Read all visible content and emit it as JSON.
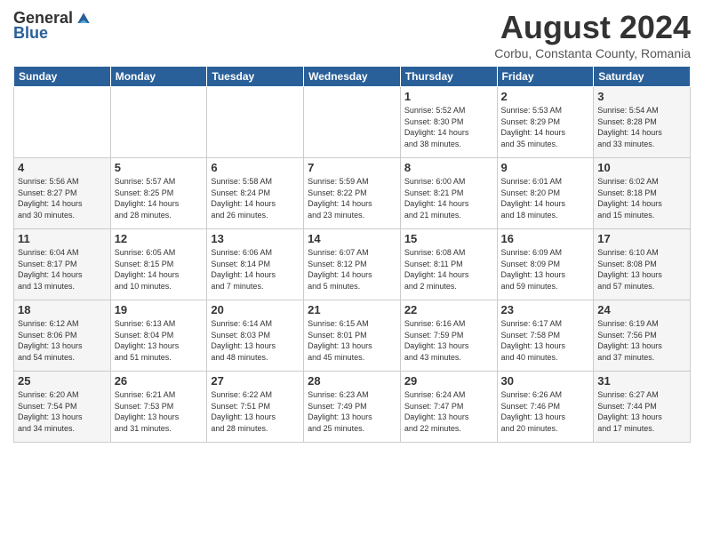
{
  "logo": {
    "general": "General",
    "blue": "Blue"
  },
  "title": "August 2024",
  "subtitle": "Corbu, Constanta County, Romania",
  "weekdays": [
    "Sunday",
    "Monday",
    "Tuesday",
    "Wednesday",
    "Thursday",
    "Friday",
    "Saturday"
  ],
  "weeks": [
    [
      {
        "day": "",
        "info": ""
      },
      {
        "day": "",
        "info": ""
      },
      {
        "day": "",
        "info": ""
      },
      {
        "day": "",
        "info": ""
      },
      {
        "day": "1",
        "info": "Sunrise: 5:52 AM\nSunset: 8:30 PM\nDaylight: 14 hours\nand 38 minutes."
      },
      {
        "day": "2",
        "info": "Sunrise: 5:53 AM\nSunset: 8:29 PM\nDaylight: 14 hours\nand 35 minutes."
      },
      {
        "day": "3",
        "info": "Sunrise: 5:54 AM\nSunset: 8:28 PM\nDaylight: 14 hours\nand 33 minutes."
      }
    ],
    [
      {
        "day": "4",
        "info": "Sunrise: 5:56 AM\nSunset: 8:27 PM\nDaylight: 14 hours\nand 30 minutes."
      },
      {
        "day": "5",
        "info": "Sunrise: 5:57 AM\nSunset: 8:25 PM\nDaylight: 14 hours\nand 28 minutes."
      },
      {
        "day": "6",
        "info": "Sunrise: 5:58 AM\nSunset: 8:24 PM\nDaylight: 14 hours\nand 26 minutes."
      },
      {
        "day": "7",
        "info": "Sunrise: 5:59 AM\nSunset: 8:22 PM\nDaylight: 14 hours\nand 23 minutes."
      },
      {
        "day": "8",
        "info": "Sunrise: 6:00 AM\nSunset: 8:21 PM\nDaylight: 14 hours\nand 21 minutes."
      },
      {
        "day": "9",
        "info": "Sunrise: 6:01 AM\nSunset: 8:20 PM\nDaylight: 14 hours\nand 18 minutes."
      },
      {
        "day": "10",
        "info": "Sunrise: 6:02 AM\nSunset: 8:18 PM\nDaylight: 14 hours\nand 15 minutes."
      }
    ],
    [
      {
        "day": "11",
        "info": "Sunrise: 6:04 AM\nSunset: 8:17 PM\nDaylight: 14 hours\nand 13 minutes."
      },
      {
        "day": "12",
        "info": "Sunrise: 6:05 AM\nSunset: 8:15 PM\nDaylight: 14 hours\nand 10 minutes."
      },
      {
        "day": "13",
        "info": "Sunrise: 6:06 AM\nSunset: 8:14 PM\nDaylight: 14 hours\nand 7 minutes."
      },
      {
        "day": "14",
        "info": "Sunrise: 6:07 AM\nSunset: 8:12 PM\nDaylight: 14 hours\nand 5 minutes."
      },
      {
        "day": "15",
        "info": "Sunrise: 6:08 AM\nSunset: 8:11 PM\nDaylight: 14 hours\nand 2 minutes."
      },
      {
        "day": "16",
        "info": "Sunrise: 6:09 AM\nSunset: 8:09 PM\nDaylight: 13 hours\nand 59 minutes."
      },
      {
        "day": "17",
        "info": "Sunrise: 6:10 AM\nSunset: 8:08 PM\nDaylight: 13 hours\nand 57 minutes."
      }
    ],
    [
      {
        "day": "18",
        "info": "Sunrise: 6:12 AM\nSunset: 8:06 PM\nDaylight: 13 hours\nand 54 minutes."
      },
      {
        "day": "19",
        "info": "Sunrise: 6:13 AM\nSunset: 8:04 PM\nDaylight: 13 hours\nand 51 minutes."
      },
      {
        "day": "20",
        "info": "Sunrise: 6:14 AM\nSunset: 8:03 PM\nDaylight: 13 hours\nand 48 minutes."
      },
      {
        "day": "21",
        "info": "Sunrise: 6:15 AM\nSunset: 8:01 PM\nDaylight: 13 hours\nand 45 minutes."
      },
      {
        "day": "22",
        "info": "Sunrise: 6:16 AM\nSunset: 7:59 PM\nDaylight: 13 hours\nand 43 minutes."
      },
      {
        "day": "23",
        "info": "Sunrise: 6:17 AM\nSunset: 7:58 PM\nDaylight: 13 hours\nand 40 minutes."
      },
      {
        "day": "24",
        "info": "Sunrise: 6:19 AM\nSunset: 7:56 PM\nDaylight: 13 hours\nand 37 minutes."
      }
    ],
    [
      {
        "day": "25",
        "info": "Sunrise: 6:20 AM\nSunset: 7:54 PM\nDaylight: 13 hours\nand 34 minutes."
      },
      {
        "day": "26",
        "info": "Sunrise: 6:21 AM\nSunset: 7:53 PM\nDaylight: 13 hours\nand 31 minutes."
      },
      {
        "day": "27",
        "info": "Sunrise: 6:22 AM\nSunset: 7:51 PM\nDaylight: 13 hours\nand 28 minutes."
      },
      {
        "day": "28",
        "info": "Sunrise: 6:23 AM\nSunset: 7:49 PM\nDaylight: 13 hours\nand 25 minutes."
      },
      {
        "day": "29",
        "info": "Sunrise: 6:24 AM\nSunset: 7:47 PM\nDaylight: 13 hours\nand 22 minutes."
      },
      {
        "day": "30",
        "info": "Sunrise: 6:26 AM\nSunset: 7:46 PM\nDaylight: 13 hours\nand 20 minutes."
      },
      {
        "day": "31",
        "info": "Sunrise: 6:27 AM\nSunset: 7:44 PM\nDaylight: 13 hours\nand 17 minutes."
      }
    ]
  ]
}
